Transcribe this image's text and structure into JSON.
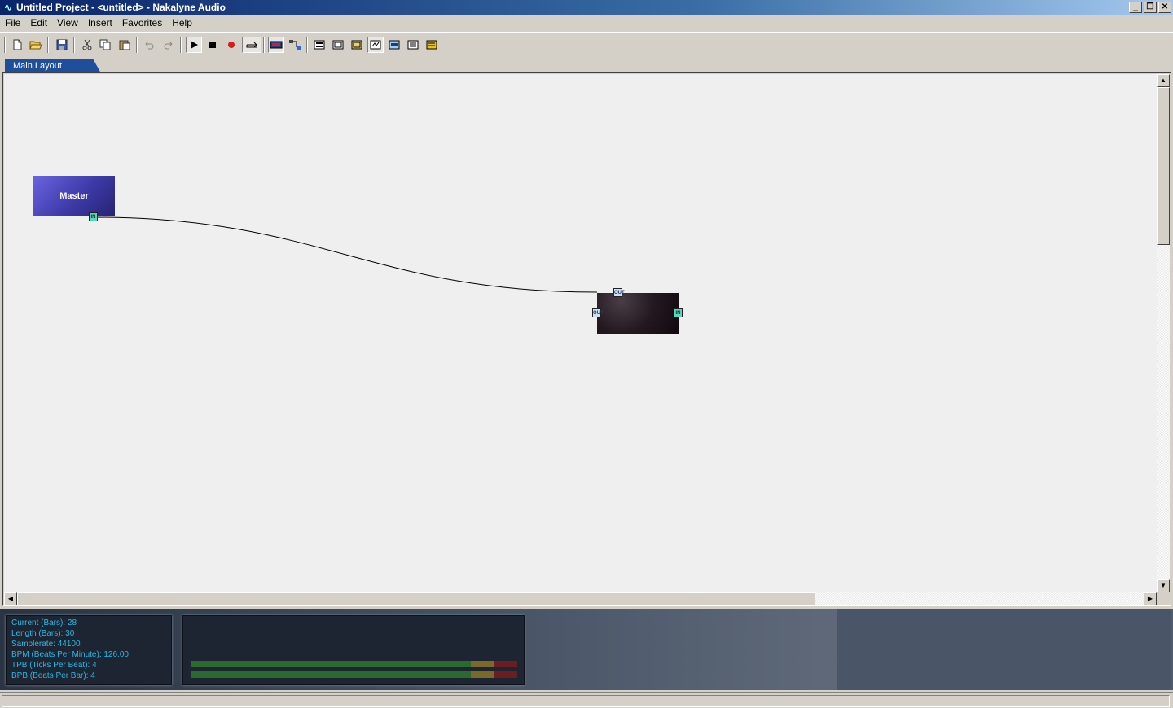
{
  "window": {
    "title": "Untitled Project - <untitled> - Nakalyne Audio",
    "app_icon": "waveform-icon",
    "buttons": {
      "minimize": "_",
      "restore": "❐",
      "close": "✕"
    }
  },
  "menu": [
    "File",
    "Edit",
    "View",
    "Insert",
    "Favorites",
    "Help"
  ],
  "toolbar": {
    "icons": [
      "new-file-icon",
      "open-folder-icon",
      "save-icon",
      "cut-icon",
      "copy-icon",
      "paste-icon",
      "undo-icon",
      "redo-icon",
      "play-icon",
      "stop-icon",
      "record-icon",
      "loop-icon",
      "device-icon",
      "routing-icon",
      "view-1-icon",
      "view-2-icon",
      "view-3-icon",
      "view-4-icon",
      "view-5-icon",
      "view-6-icon",
      "view-7-icon"
    ]
  },
  "tabs": [
    {
      "label": "Main Layout",
      "active": true
    }
  ],
  "nodes": {
    "master": {
      "label": "Master",
      "port_in": "IN"
    },
    "unit": {
      "port_top": "OUT",
      "port_left": "OUT",
      "port_right": "IN"
    }
  },
  "info": {
    "current": "Current (Bars): 28",
    "length": "Length (Bars): 30",
    "samplerate": "Samplerate: 44100",
    "bpm": "BPM (Beats Per Minute): 126.00",
    "tpb": "TPB (Ticks Per Beat): 4",
    "bpb": "BPB (Beats Per Bar): 4"
  },
  "meters": {
    "left_level": 0.86,
    "right_level": 0.86
  },
  "colors": {
    "info_text": "#28b8e8",
    "master_node": "#4b47c4",
    "tab_active": "#1f4e9c"
  }
}
